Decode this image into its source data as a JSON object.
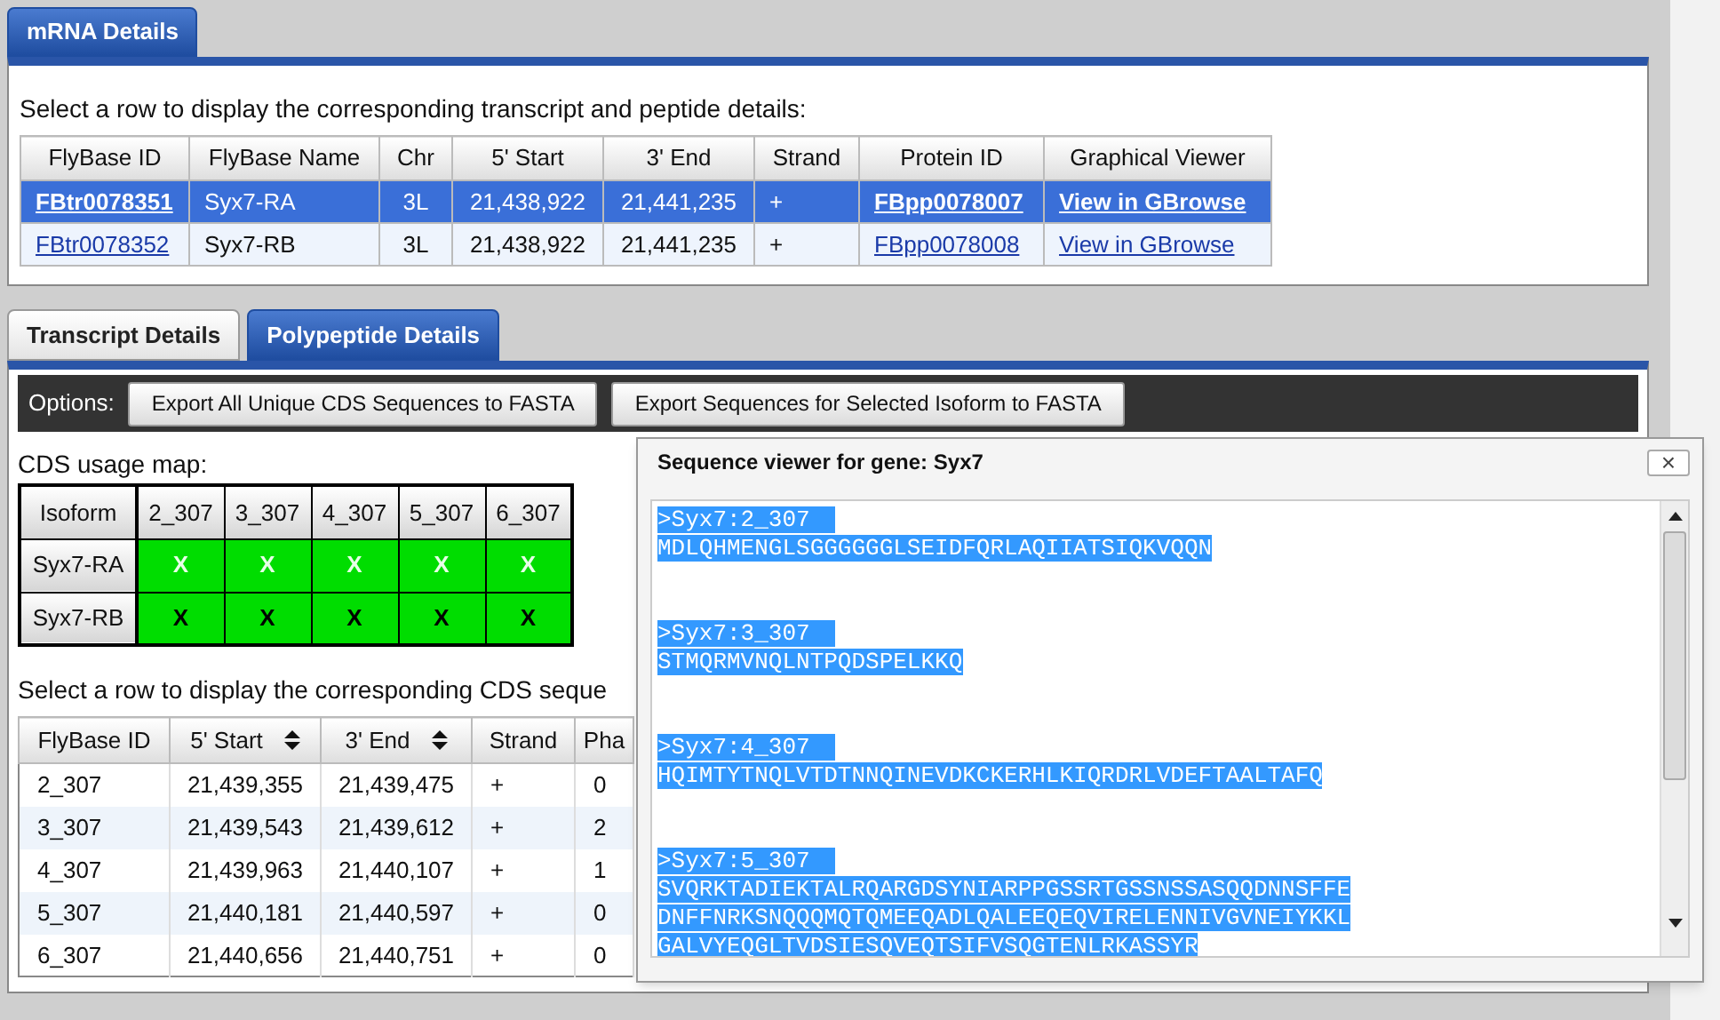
{
  "mrna_tabs": [
    {
      "label": "mRNA Details",
      "selected": true
    }
  ],
  "mrna_panel": {
    "instruction": "Select a row to display the corresponding transcript and peptide details:",
    "table": {
      "columns": [
        {
          "label": "FlyBase ID",
          "kind": "link"
        },
        {
          "label": "FlyBase Name",
          "kind": "text"
        },
        {
          "label": "Chr",
          "kind": "text"
        },
        {
          "label": "5' Start",
          "kind": "text"
        },
        {
          "label": "3' End",
          "kind": "text"
        },
        {
          "label": "Strand",
          "kind": "text"
        },
        {
          "label": "Protein ID",
          "kind": "link"
        },
        {
          "label": "Graphical Viewer",
          "kind": "link"
        }
      ],
      "rows": [
        {
          "selected": true,
          "cells": [
            "FBtr0078351",
            "Syx7-RA",
            "3L",
            "21,438,922",
            "21,441,235",
            "+",
            "FBpp0078007",
            "View in GBrowse"
          ]
        },
        {
          "selected": false,
          "cells": [
            "FBtr0078352",
            "Syx7-RB",
            "3L",
            "21,438,922",
            "21,441,235",
            "+",
            "FBpp0078008",
            "View in GBrowse"
          ]
        }
      ]
    }
  },
  "detail_tabs": [
    {
      "label": "Transcript Details",
      "selected": false
    },
    {
      "label": "Polypeptide Details",
      "selected": true
    }
  ],
  "options": {
    "label": "Options:",
    "buttons": [
      "Export All Unique CDS Sequences to FASTA",
      "Export Sequences for Selected Isoform to FASTA"
    ]
  },
  "cds_usage_map": {
    "title": "CDS usage map:",
    "columns": [
      "Isoform",
      "2_307",
      "3_307",
      "4_307",
      "5_307",
      "6_307"
    ],
    "rows": [
      {
        "selected": true,
        "cells": [
          "Syx7-RA",
          "X",
          "X",
          "X",
          "X",
          "X"
        ]
      },
      {
        "selected": false,
        "cells": [
          "Syx7-RB",
          "X",
          "X",
          "X",
          "X",
          "X"
        ]
      }
    ]
  },
  "cds_instruction": "Select a row to display the corresponding CDS seque",
  "cds_table": {
    "columns": [
      {
        "label": "FlyBase ID",
        "sortable": false
      },
      {
        "label": "5' Start",
        "sortable": true
      },
      {
        "label": "3' End",
        "sortable": true
      },
      {
        "label": "Strand",
        "sortable": false
      },
      {
        "label": "Pha",
        "sortable": false
      }
    ],
    "rows": [
      [
        "2_307",
        "21,439,355",
        "21,439,475",
        "+",
        "0"
      ],
      [
        "3_307",
        "21,439,543",
        "21,439,612",
        "+",
        "2"
      ],
      [
        "4_307",
        "21,439,963",
        "21,440,107",
        "+",
        "1"
      ],
      [
        "5_307",
        "21,440,181",
        "21,440,597",
        "+",
        "0"
      ],
      [
        "6_307",
        "21,440,656",
        "21,440,751",
        "+",
        "0"
      ]
    ]
  },
  "sequence_viewer": {
    "title": "Sequence viewer for gene: Syx7",
    "close": "×",
    "entries": [
      {
        "header": ">Syx7:2_307",
        "lines": [
          "MDLQHMENGLSGGGGGGLSEIDFQRLAQIIATSIQKVQQN"
        ]
      },
      {
        "header": ">Syx7:3_307",
        "lines": [
          "STMQRMVNQLNTPQDSPELKKQ"
        ]
      },
      {
        "header": ">Syx7:4_307",
        "lines": [
          "HQIMTYTNQLVTDTNNQINEVDKCKERHLKIQRDRLVDEFTAALTAFQ"
        ]
      },
      {
        "header": ">Syx7:5_307",
        "lines": [
          "SVQRKTADIEKTALRQARGDSYNIARPPGSSRTGSSNSSASQQDNNSFFE",
          "DNFFNRKSNQQQMQTQMEEQADLQALEEQEQVIRELENNIVGVNEIYKKL",
          "GALVYEQGLTVDSIESQVEQTSIFVSQGTENLRKASSYR"
        ]
      }
    ]
  }
}
